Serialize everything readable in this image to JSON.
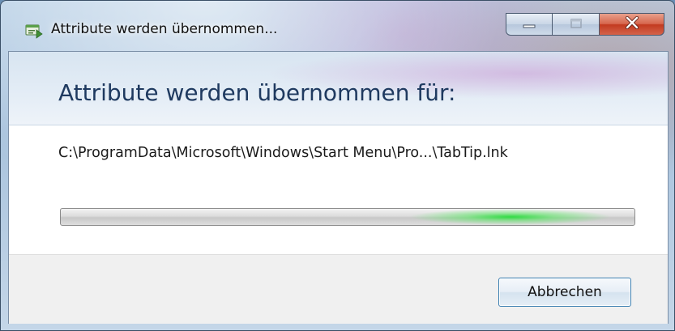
{
  "window": {
    "title": "Attribute werden übernommen...",
    "caption": {
      "minimize_icon": "minimize-icon",
      "maximize_icon": "maximize-icon",
      "close_icon": "close-icon"
    }
  },
  "dialog": {
    "heading": "Attribute werden übernommen für:",
    "path": "C:\\ProgramData\\Microsoft\\Windows\\Start Menu\\Pro...\\TabTip.lnk",
    "progress": {
      "mode": "indeterminate",
      "accent_color": "#2fd34a"
    }
  },
  "footer": {
    "cancel_label": "Abbrechen"
  },
  "colors": {
    "heading": "#1f3a60",
    "close_button": "#c8452b"
  }
}
